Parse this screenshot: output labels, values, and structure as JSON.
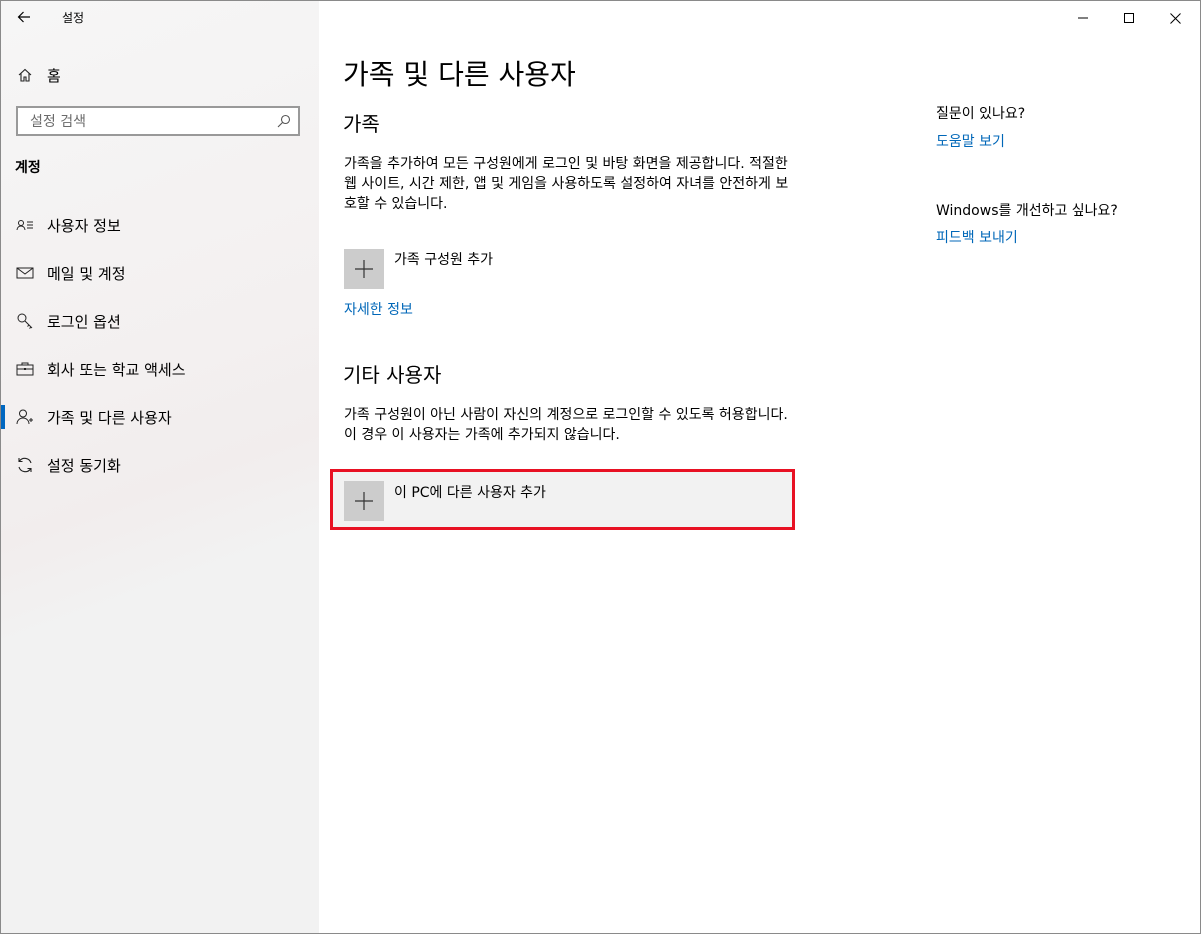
{
  "app": {
    "title": "설정"
  },
  "sidebar": {
    "home_label": "홈",
    "search": {
      "placeholder": "설정 검색"
    },
    "section_header": "계정",
    "items": [
      {
        "label": "사용자 정보",
        "icon": "user-info-icon"
      },
      {
        "label": "메일 및 계정",
        "icon": "mail-icon"
      },
      {
        "label": "로그인 옵션",
        "icon": "key-icon"
      },
      {
        "label": "회사 또는 학교 액세스",
        "icon": "briefcase-icon"
      },
      {
        "label": "가족 및 다른 사용자",
        "icon": "person-icon",
        "selected": true
      },
      {
        "label": "설정 동기화",
        "icon": "sync-icon"
      }
    ]
  },
  "main": {
    "title": "가족 및 다른 사용자",
    "family": {
      "heading": "가족",
      "description": "가족을 추가하여 모든 구성원에게 로그인 및 바탕 화면을 제공합니다. 적절한 웹 사이트, 시간 제한, 앱 및 게임을 사용하도록 설정하여 자녀를 안전하게 보호할 수 있습니다.",
      "add_label": "가족 구성원 추가",
      "more_info_link": "자세한 정보"
    },
    "other_users": {
      "heading": "기타 사용자",
      "description": "가족 구성원이 아닌 사람이 자신의 계정으로 로그인할 수 있도록 허용합니다. 이 경우 이 사용자는 가족에 추가되지 않습니다.",
      "add_label": "이 PC에 다른 사용자 추가"
    },
    "help": {
      "question": "질문이 있나요?",
      "help_link": "도움말 보기",
      "improve_question": "Windows를 개선하고 싶나요?",
      "feedback_link": "피드백 보내기"
    }
  },
  "colors": {
    "accent": "#0067b8",
    "highlight_border": "#e81123"
  }
}
